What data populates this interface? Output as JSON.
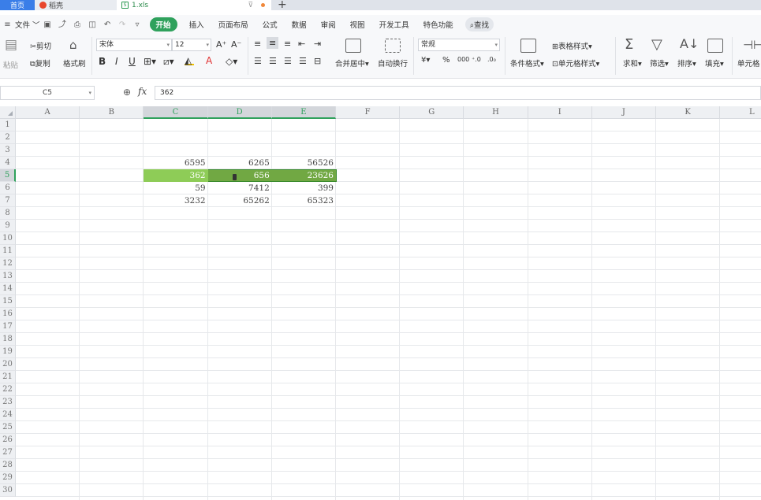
{
  "tabs": {
    "home": "首页",
    "daoke": "稻壳",
    "file": "1.xls"
  },
  "menu": {
    "file": "文件",
    "items": [
      "开始",
      "插入",
      "页面布局",
      "公式",
      "数据",
      "审阅",
      "视图",
      "开发工具",
      "特色功能"
    ],
    "active_index": 0,
    "search": "查找"
  },
  "ribbon": {
    "paste": "粘贴",
    "cut": "剪切",
    "copy": "复制",
    "format_painter": "格式刷",
    "font_name": "宋体",
    "font_size": "12",
    "merge_center": "合并居中",
    "wrap_text": "自动换行",
    "number_format": "常规",
    "conditional_format": "条件格式",
    "table_style": "表格样式",
    "cell_style": "单元格样式",
    "sum": "求和",
    "filter": "筛选",
    "sort": "排序",
    "fill": "填充",
    "cell": "单元格",
    "colors": {
      "accent": "#2fa15c",
      "font_color": "#e03030",
      "fill_color": "#f2c200"
    }
  },
  "formula_bar": {
    "cell_ref": "C5",
    "value": "362"
  },
  "sheet": {
    "columns": [
      "A",
      "B",
      "C",
      "D",
      "E",
      "F",
      "G",
      "H",
      "I",
      "J",
      "K",
      "L"
    ],
    "highlighted_columns": [
      "C",
      "D",
      "E"
    ],
    "rows": [
      "1",
      "2",
      "3",
      "4",
      "5",
      "6",
      "7",
      "8",
      "9",
      "10",
      "11",
      "12",
      "13",
      "14",
      "15",
      "16",
      "17",
      "18",
      "19",
      "20",
      "21",
      "22",
      "23",
      "24",
      "25",
      "26",
      "27",
      "28",
      "29",
      "30"
    ],
    "highlighted_row": "5",
    "cells": [
      {
        "ref": "C4",
        "value": "6595"
      },
      {
        "ref": "D4",
        "value": "6265"
      },
      {
        "ref": "E4",
        "value": "56526"
      },
      {
        "ref": "C5",
        "value": "362"
      },
      {
        "ref": "D5",
        "value": "656"
      },
      {
        "ref": "E5",
        "value": "23626"
      },
      {
        "ref": "C6",
        "value": "59"
      },
      {
        "ref": "D6",
        "value": "7412"
      },
      {
        "ref": "E6",
        "value": "399"
      },
      {
        "ref": "C7",
        "value": "3232"
      },
      {
        "ref": "D7",
        "value": "65262"
      },
      {
        "ref": "E7",
        "value": "65323"
      }
    ],
    "selection_fill": "#71a843",
    "active_fill": "#8ecc57"
  }
}
